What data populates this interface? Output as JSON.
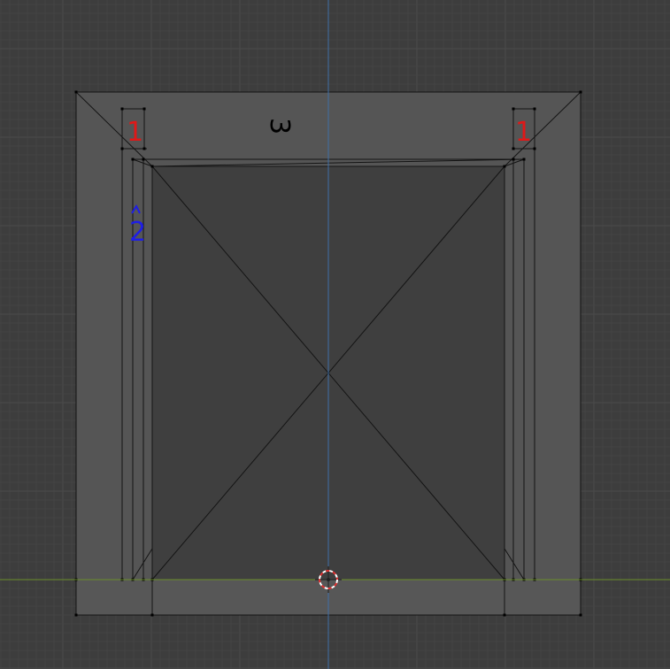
{
  "viewport": {
    "background_color": "#3d3d3d",
    "grid_minor_color": "#444444",
    "grid_major_color": "#4a4a4a",
    "axis_x_color": "#6b8f2a",
    "axis_z_color": "#3f6fa8",
    "face_color": "#555555",
    "inner_face_color": "#3f3f3f",
    "edge_color": "#141414",
    "vertex_color": "#000000"
  },
  "annotations": {
    "label_1_left": {
      "text": "1",
      "color": "#e01818"
    },
    "label_1_right": {
      "text": "1",
      "color": "#e01818"
    },
    "label_2": {
      "text": "2",
      "color": "#1e1ee6"
    },
    "label_3": {
      "text": "3",
      "color": "#000000"
    }
  },
  "cursor_3d": {
    "name": "3d-cursor-icon",
    "ring_colors": [
      "#e03030",
      "#ffffff"
    ]
  }
}
